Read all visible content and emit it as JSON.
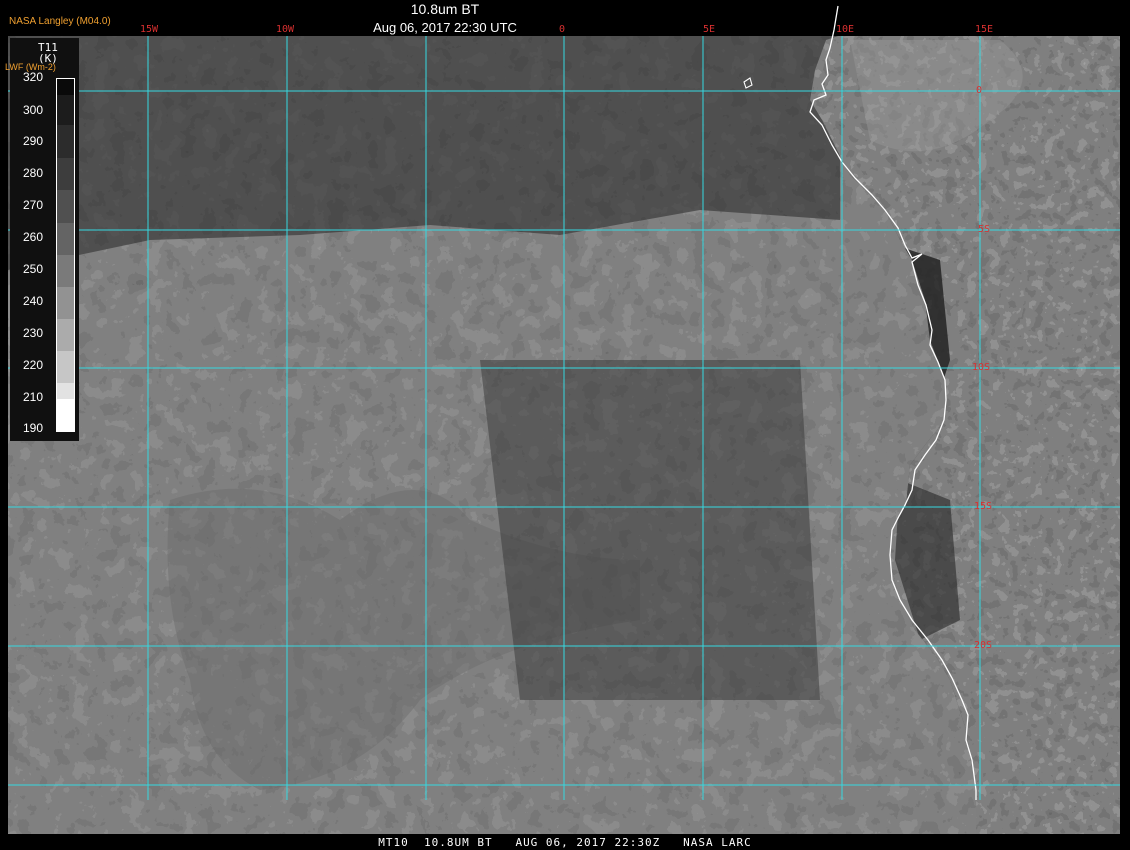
{
  "header": {
    "title": "10.8um BT",
    "subtitle": "Aug 06, 2017 22:30 UTC",
    "producer": "NASA Langley (M04.0)"
  },
  "legend": {
    "title_line1": "T11",
    "title_line2": "(K)",
    "alt_label": "LWF (Wm-2)",
    "labels": [
      "320",
      "300",
      "290",
      "280",
      "270",
      "260",
      "250",
      "240",
      "230",
      "220",
      "210",
      "190"
    ]
  },
  "grid": {
    "longitudes": [
      "15W",
      "10W",
      "0",
      "5E",
      "10E",
      "15E"
    ],
    "latitudes": [
      "0",
      "5S",
      "10S",
      "15S",
      "20S"
    ],
    "line_color": "#36d8e0",
    "label_color": "#d83030"
  },
  "footer": {
    "text": "MT10  10.8UM BT   AUG 06, 2017 22:30Z   NASA LARC"
  },
  "colors": {
    "coastline": "#ffffff",
    "background": "#000000",
    "producer_text": "#f0a030"
  }
}
